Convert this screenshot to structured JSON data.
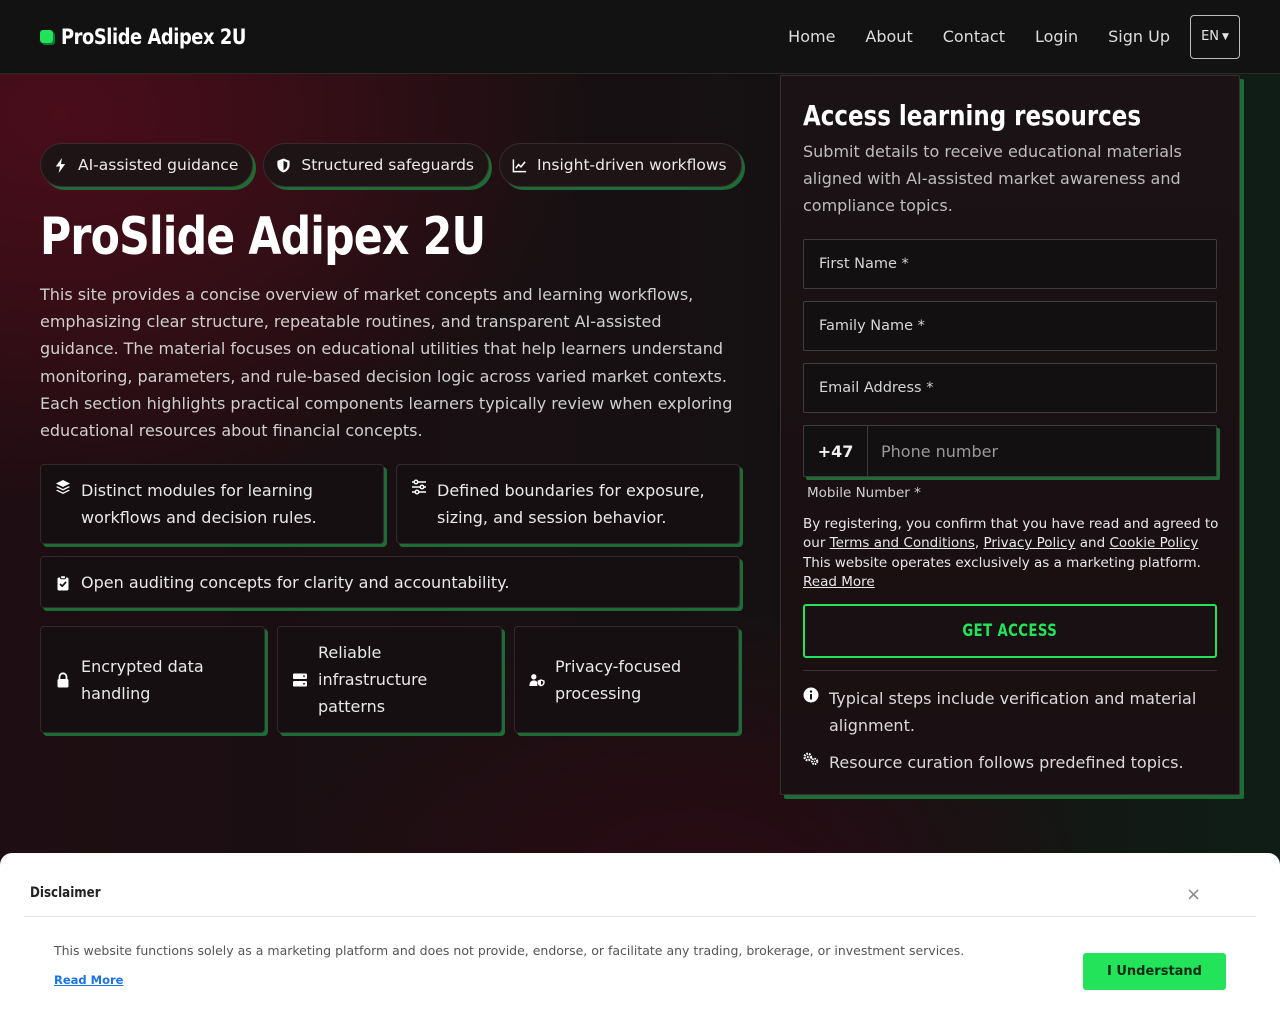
{
  "nav": {
    "brand": "ProSlide Adipex 2U",
    "links": [
      "Home",
      "About",
      "Contact",
      "Login",
      "Sign Up"
    ],
    "language": "EN"
  },
  "hero": {
    "pills": [
      "AI-assisted guidance",
      "Structured safeguards",
      "Insight-driven workflows"
    ],
    "title": "ProSlide Adipex 2U",
    "description": "This site provides a concise overview of market concepts and learning workflows, emphasizing clear structure, repeatable routines, and transparent AI-assisted guidance. The material focuses on educational utilities that help learners understand monitoring, parameters, and rule-based decision logic across varied market contexts. Each section highlights practical components learners typically review when exploring educational resources about financial concepts.",
    "features": [
      "Distinct modules for learning workflows and decision rules.",
      "Defined boundaries for exposure, sizing, and session behavior.",
      "Open auditing concepts for clarity and accountability."
    ],
    "trust": [
      "Encrypted data handling",
      "Reliable infrastructure patterns",
      "Privacy-focused processing"
    ]
  },
  "form": {
    "title": "Access learning resources",
    "subtitle": "Submit details to receive educational materials aligned with AI-assisted market awareness and compliance topics.",
    "first_name_label": "First Name *",
    "family_name_label": "Family Name *",
    "email_label": "Email Address *",
    "phone_code": "+47",
    "phone_placeholder": "Phone number",
    "mobile_label": "Mobile Number *",
    "consent_prefix": "By registering, you confirm that you have read and agreed to our ",
    "terms_link": "Terms and Conditions",
    "comma": ", ",
    "privacy_link": "Privacy Policy",
    "and": " and ",
    "cookie_link": "Cookie Policy",
    "consent_suffix": " This website operates exclusively as a marketing platform. ",
    "read_more": "Read More",
    "cta": "GET ACCESS",
    "notes": [
      "Typical steps include verification and material alignment.",
      "Resource curation follows predefined topics."
    ]
  },
  "disclaimer": {
    "title": "Disclaimer",
    "close": "×",
    "text": "This website functions solely as a marketing platform and does not provide, endorse, or facilitate any trading, brokerage, or investment services.",
    "read_more": "Read More",
    "button": "I Understand"
  },
  "colors": {
    "accent": "#22e35a",
    "accent_shadow": "#1d6b35",
    "hero_red": "#4a0d1a"
  },
  "icons": {
    "pills": [
      "bolt-icon",
      "shield-icon",
      "chart-line-icon"
    ],
    "features": [
      "layers-icon",
      "sliders-icon",
      "clipboard-check-icon"
    ],
    "trust": [
      "lock-icon",
      "server-icon",
      "user-shield-icon"
    ],
    "notes": [
      "info-icon",
      "gears-icon"
    ]
  }
}
